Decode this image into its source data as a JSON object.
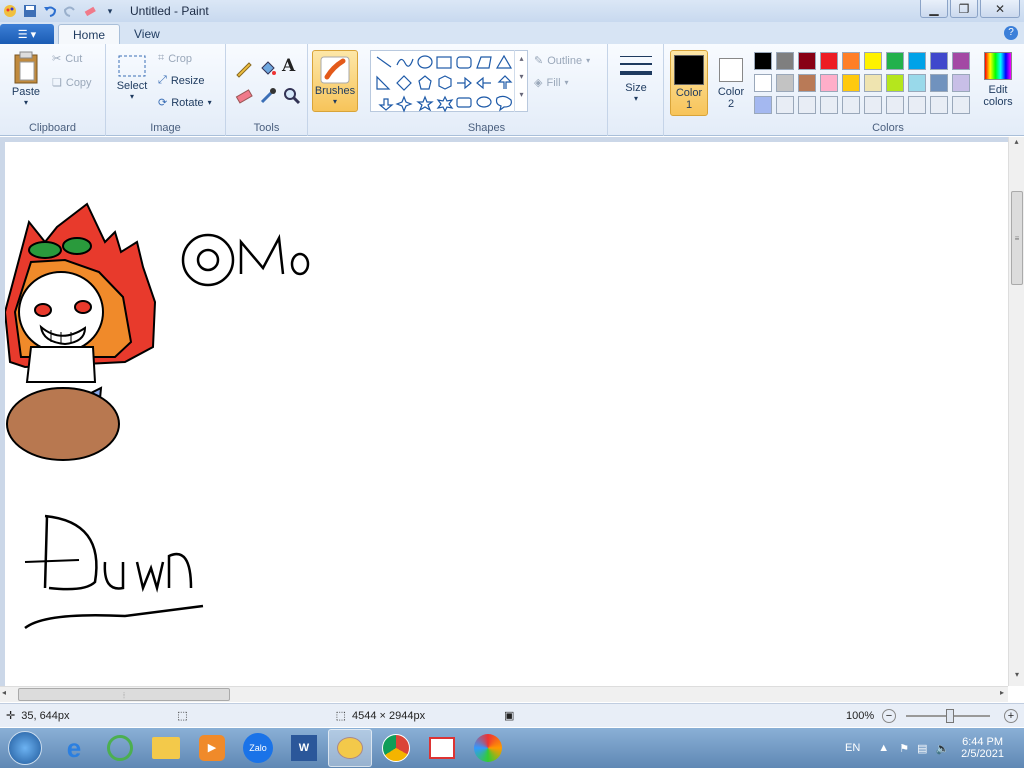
{
  "window": {
    "title": "Untitled - Paint"
  },
  "tabs": {
    "home": "Home",
    "view": "View"
  },
  "clipboard": {
    "paste": "Paste",
    "cut": "Cut",
    "copy": "Copy",
    "label": "Clipboard"
  },
  "image": {
    "select": "Select",
    "crop": "Crop",
    "resize": "Resize",
    "rotate": "Rotate",
    "label": "Image"
  },
  "tools": {
    "label": "Tools"
  },
  "brushes": {
    "label": "Brushes"
  },
  "shapes": {
    "outline": "Outline",
    "fill": "Fill",
    "label": "Shapes"
  },
  "size": {
    "label": "Size"
  },
  "color1": {
    "label_top": "Color",
    "label_bottom": "1"
  },
  "color2": {
    "label_top": "Color",
    "label_bottom": "2"
  },
  "colors": {
    "label": "Colors",
    "edit_top": "Edit",
    "edit_bottom": "colors",
    "palette_row1": [
      "#000000",
      "#7f7f7f",
      "#880015",
      "#ed1c24",
      "#ff7f27",
      "#fff200",
      "#22b14c",
      "#00a2e8",
      "#3f48cc",
      "#a349a4"
    ],
    "palette_row2": [
      "#ffffff",
      "#c3c3c3",
      "#b97a57",
      "#ffaec9",
      "#ffc90e",
      "#efe4b0",
      "#b5e61d",
      "#99d9ea",
      "#7092be",
      "#c8bfe7"
    ],
    "palette_row3": [
      "#a4b8f0",
      "#e8edf5",
      "#e8edf5",
      "#e8edf5",
      "#e8edf5",
      "#e8edf5",
      "#e8edf5",
      "#e8edf5",
      "#e8edf5",
      "#e8edf5"
    ]
  },
  "status": {
    "cursor": "35, 644px",
    "dimensions": "4544 × 2944px",
    "zoom": "100%"
  },
  "tray": {
    "lang": "EN",
    "time": "6:44 PM",
    "date": "2/5/2021"
  },
  "taskbar_apps": {
    "zalo": "Zalo"
  }
}
